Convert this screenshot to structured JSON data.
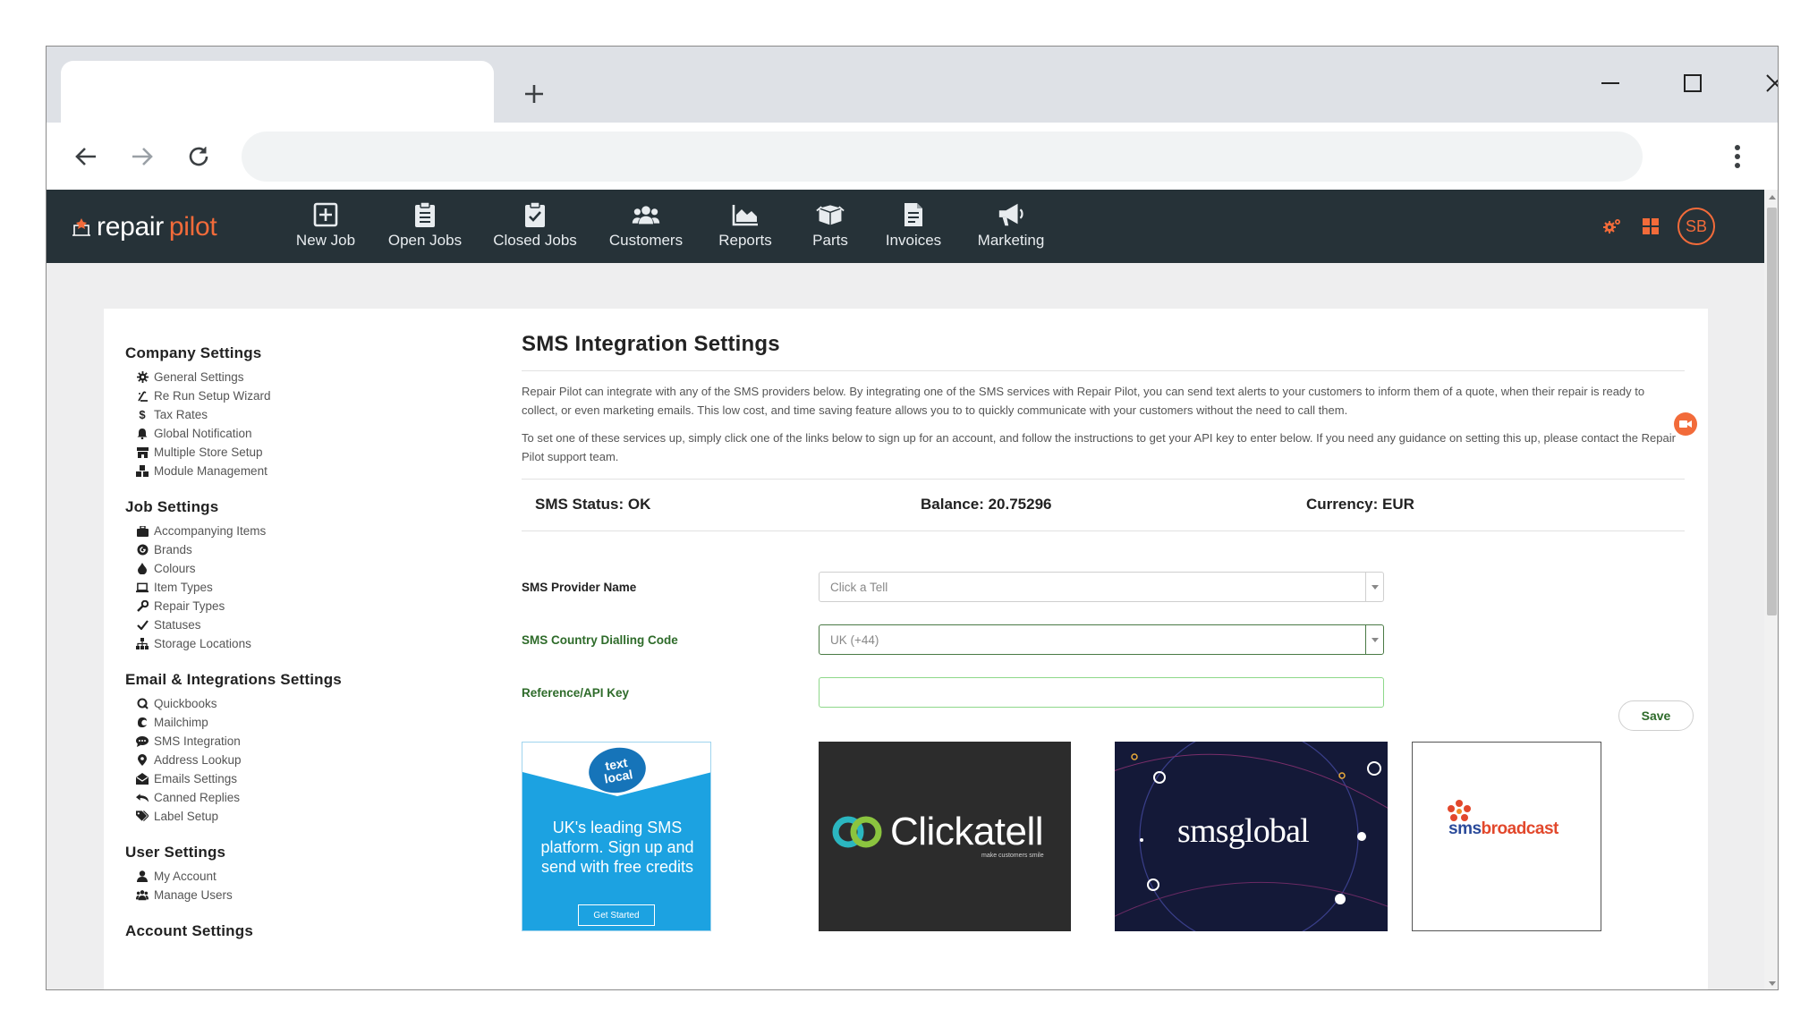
{
  "browser": {
    "new_tab_symbol": "+",
    "address_value": "",
    "icons": [
      "back-arrow-icon",
      "forward-arrow-icon",
      "reload-icon",
      "kebab-menu-icon",
      "minimize-icon",
      "maximize-icon",
      "close-icon"
    ]
  },
  "app": {
    "logo": {
      "part1": "repair",
      "part2": "pilot"
    },
    "brand_color": "#f26b3a",
    "nav_bg": "#263238",
    "nav": [
      {
        "label": "New Job",
        "icon": "plus-square-icon"
      },
      {
        "label": "Open Jobs",
        "icon": "clipboard-list-icon"
      },
      {
        "label": "Closed Jobs",
        "icon": "clipboard-check-icon"
      },
      {
        "label": "Customers",
        "icon": "users-icon"
      },
      {
        "label": "Reports",
        "icon": "area-chart-icon"
      },
      {
        "label": "Parts",
        "icon": "box-icon"
      },
      {
        "label": "Invoices",
        "icon": "invoice-icon"
      },
      {
        "label": "Marketing",
        "icon": "megaphone-icon"
      }
    ],
    "avatar_initials": "SB"
  },
  "sidebar": {
    "sections": [
      {
        "title": "Company Settings",
        "items": [
          {
            "label": "General Settings",
            "icon": "gear-icon"
          },
          {
            "label": "Re Run Setup Wizard",
            "icon": "wizard-icon"
          },
          {
            "label": "Tax Rates",
            "icon": "dollar-icon"
          },
          {
            "label": "Global Notification",
            "icon": "bell-icon"
          },
          {
            "label": "Multiple Store Setup",
            "icon": "store-icon"
          },
          {
            "label": "Module Management",
            "icon": "cubes-icon"
          }
        ]
      },
      {
        "title": "Job Settings",
        "items": [
          {
            "label": "Accompanying Items",
            "icon": "briefcase-icon"
          },
          {
            "label": "Brands",
            "icon": "brand-icon"
          },
          {
            "label": "Colours",
            "icon": "droplet-icon"
          },
          {
            "label": "Item Types",
            "icon": "laptop-icon"
          },
          {
            "label": "Repair Types",
            "icon": "wrench-icon"
          },
          {
            "label": "Statuses",
            "icon": "check-icon"
          },
          {
            "label": "Storage Locations",
            "icon": "sitemap-icon"
          }
        ]
      },
      {
        "title": "Email & Integrations Settings",
        "items": [
          {
            "label": "Quickbooks",
            "icon": "quickbooks-icon"
          },
          {
            "label": "Mailchimp",
            "icon": "mailchimp-icon"
          },
          {
            "label": "SMS Integration",
            "icon": "sms-icon"
          },
          {
            "label": "Address Lookup",
            "icon": "map-marker-icon"
          },
          {
            "label": "Emails Settings",
            "icon": "envelope-open-icon"
          },
          {
            "label": "Canned Replies",
            "icon": "reply-all-icon"
          },
          {
            "label": "Label Setup",
            "icon": "tags-icon"
          }
        ]
      },
      {
        "title": "User Settings",
        "items": [
          {
            "label": "My Account",
            "icon": "user-icon"
          },
          {
            "label": "Manage Users",
            "icon": "users-cog-icon"
          }
        ]
      },
      {
        "title": "Account Settings",
        "items": []
      }
    ]
  },
  "main": {
    "title": "SMS Integration Settings",
    "intro_1": "Repair Pilot can integrate with any of the SMS providers below. By integrating one of the SMS services with Repair Pilot, you can send text alerts to your customers to inform them of a quote, when their repair is ready to collect, or even marketing emails. This low cost, and time saving feature allows you to to quickly communicate with your customers without the need to call them.",
    "intro_2": "To set one of these services up, simply click one of the links below to sign up for an account, and follow the instructions to get your API key to enter below. If you need any guidance on setting this up, please contact the Repair Pilot support team.",
    "status": {
      "sms_status": "SMS Status: OK",
      "balance": "Balance: 20.75296",
      "currency": "Currency: EUR"
    },
    "form": {
      "provider_label": "SMS Provider Name",
      "provider_value": "Click a Tell",
      "dialling_label": "SMS Country Dialling Code",
      "dialling_value": "UK (+44)",
      "apikey_label": "Reference/API Key",
      "apikey_value": "",
      "save_label": "Save"
    },
    "providers": {
      "textlocal": {
        "logo_line1": "text",
        "logo_line2": "local",
        "tagline": "UK's leading SMS platform. Sign up and send with free credits",
        "cta": "Get Started",
        "bg": "#1ca2e1"
      },
      "clickatell": {
        "name": "Clickatell",
        "slogan": "make customers smile",
        "bg": "#2c2c2c",
        "accent": "#2bb6c0"
      },
      "smsglobal": {
        "name": "smsglobal",
        "bg": "#141938"
      },
      "smsbroadcast": {
        "name_part1": "sms",
        "name_part2": "broadcast"
      }
    }
  }
}
